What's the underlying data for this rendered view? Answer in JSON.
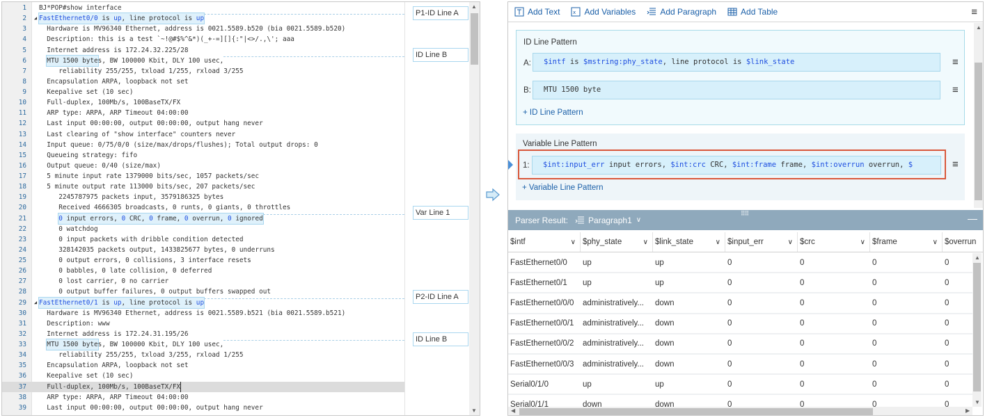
{
  "editor": {
    "lines": [
      {
        "n": "1",
        "pre": "",
        "hl": [],
        "rest": "BJ*POP#show interface"
      },
      {
        "n": "2",
        "mark": "◢",
        "pre": "",
        "hl": [
          {
            "t": "FastEthernet0/0",
            "v": true
          },
          {
            "t": " is "
          },
          {
            "t": "up",
            "v": true
          },
          {
            "t": ", line protocol is "
          },
          {
            "t": "up",
            "v": true
          }
        ],
        "rest": "",
        "dash": true
      },
      {
        "n": "3",
        "pre": "",
        "hl": [],
        "rest": "  Hardware is MV96340 Ethernet, address is 0021.5589.b520 (bia 0021.5589.b520)"
      },
      {
        "n": "4",
        "pre": "",
        "hl": [],
        "rest": "  Description: this is a test `~!@#$%^&*)(_+-=][]{:\"|<>/.,\\'; aaa"
      },
      {
        "n": "5",
        "pre": "",
        "hl": [],
        "rest": "  Internet address is 172.24.32.225/28"
      },
      {
        "n": "6",
        "pre": "  ",
        "hl": [
          {
            "t": "MTU 1500 byte"
          }
        ],
        "rest": "s, BW 100000 Kbit, DLY 100 usec,",
        "dash": true
      },
      {
        "n": "7",
        "pre": "",
        "hl": [],
        "rest": "     reliability 255/255, txload 1/255, rxload 3/255"
      },
      {
        "n": "8",
        "pre": "",
        "hl": [],
        "rest": "  Encapsulation ARPA, loopback not set"
      },
      {
        "n": "9",
        "pre": "",
        "hl": [],
        "rest": "  Keepalive set (10 sec)"
      },
      {
        "n": "10",
        "pre": "",
        "hl": [],
        "rest": "  Full-duplex, 100Mb/s, 100BaseTX/FX"
      },
      {
        "n": "11",
        "pre": "",
        "hl": [],
        "rest": "  ARP type: ARPA, ARP Timeout 04:00:00"
      },
      {
        "n": "12",
        "pre": "",
        "hl": [],
        "rest": "  Last input 00:00:00, output 00:00:00, output hang never"
      },
      {
        "n": "13",
        "pre": "",
        "hl": [],
        "rest": "  Last clearing of \"show interface\" counters never"
      },
      {
        "n": "14",
        "pre": "",
        "hl": [],
        "rest": "  Input queue: 0/75/0/0 (size/max/drops/flushes); Total output drops: 0"
      },
      {
        "n": "15",
        "pre": "",
        "hl": [],
        "rest": "  Queueing strategy: fifo"
      },
      {
        "n": "16",
        "pre": "",
        "hl": [],
        "rest": "  Output queue: 0/40 (size/max)"
      },
      {
        "n": "17",
        "pre": "",
        "hl": [],
        "rest": "  5 minute input rate 1379000 bits/sec, 1057 packets/sec"
      },
      {
        "n": "18",
        "pre": "",
        "hl": [],
        "rest": "  5 minute output rate 113000 bits/sec, 207 packets/sec"
      },
      {
        "n": "19",
        "pre": "",
        "hl": [],
        "rest": "     2245787975 packets input, 3579186325 bytes"
      },
      {
        "n": "20",
        "pre": "",
        "hl": [],
        "rest": "     Received 4666305 broadcasts, 0 runts, 0 giants, 0 throttles"
      },
      {
        "n": "21",
        "pre": "     ",
        "hl": [
          {
            "t": "0",
            "v": true
          },
          {
            "t": " input errors, "
          },
          {
            "t": "0",
            "v": true
          },
          {
            "t": " CRC, "
          },
          {
            "t": "0",
            "v": true
          },
          {
            "t": " frame, "
          },
          {
            "t": "0",
            "v": true
          },
          {
            "t": " overrun, "
          },
          {
            "t": "0",
            "v": true
          },
          {
            "t": " ignored"
          }
        ],
        "rest": "",
        "dash": true
      },
      {
        "n": "22",
        "pre": "",
        "hl": [],
        "rest": "     0 watchdog"
      },
      {
        "n": "23",
        "pre": "",
        "hl": [],
        "rest": "     0 input packets with dribble condition detected"
      },
      {
        "n": "24",
        "pre": "",
        "hl": [],
        "rest": "     328142035 packets output, 1433825677 bytes, 0 underruns"
      },
      {
        "n": "25",
        "pre": "",
        "hl": [],
        "rest": "     0 output errors, 0 collisions, 3 interface resets"
      },
      {
        "n": "26",
        "pre": "",
        "hl": [],
        "rest": "     0 babbles, 0 late collision, 0 deferred"
      },
      {
        "n": "27",
        "pre": "",
        "hl": [],
        "rest": "     0 lost carrier, 0 no carrier"
      },
      {
        "n": "28",
        "pre": "",
        "hl": [],
        "rest": "     0 output buffer failures, 0 output buffers swapped out"
      },
      {
        "n": "29",
        "mark": "◢",
        "pre": "",
        "hl": [
          {
            "t": "FastEthernet0/1",
            "v": true
          },
          {
            "t": " is "
          },
          {
            "t": "up",
            "v": true
          },
          {
            "t": ", line protocol is "
          },
          {
            "t": "up",
            "v": true
          }
        ],
        "rest": "",
        "dash": true
      },
      {
        "n": "30",
        "pre": "",
        "hl": [],
        "rest": "  Hardware is MV96340 Ethernet, address is 0021.5589.b521 (bia 0021.5589.b521)"
      },
      {
        "n": "31",
        "pre": "",
        "hl": [],
        "rest": "  Description: www"
      },
      {
        "n": "32",
        "pre": "",
        "hl": [],
        "rest": "  Internet address is 172.24.31.195/26"
      },
      {
        "n": "33",
        "pre": "  ",
        "hl": [
          {
            "t": "MTU 1500 byte"
          }
        ],
        "rest": "s, BW 100000 Kbit, DLY 100 usec,",
        "dash": true
      },
      {
        "n": "34",
        "pre": "",
        "hl": [],
        "rest": "     reliability 255/255, txload 3/255, rxload 1/255"
      },
      {
        "n": "35",
        "pre": "",
        "hl": [],
        "rest": "  Encapsulation ARPA, loopback not set"
      },
      {
        "n": "36",
        "pre": "",
        "hl": [],
        "rest": "  Keepalive set (10 sec)"
      },
      {
        "n": "37",
        "pre": "",
        "hl": [],
        "rest": "  Full-duplex, 100Mb/s, 100BaseTX/FX",
        "current": true
      },
      {
        "n": "38",
        "pre": "",
        "hl": [],
        "rest": "  ARP type: ARPA, ARP Timeout 04:00:00"
      },
      {
        "n": "39",
        "pre": "",
        "hl": [],
        "rest": "  Last input 00:00:00, output 00:00:00, output hang never"
      }
    ],
    "annotations": [
      "P1-ID Line A",
      "ID Line B",
      "Var Line 1",
      "P2-ID Line A",
      "ID Line B"
    ]
  },
  "toolbar": {
    "add_text": "Add Text",
    "add_variables": "Add Variables",
    "add_paragraph": "Add Paragraph",
    "add_table": "Add Table"
  },
  "id_pattern": {
    "title": "ID Line Pattern",
    "a_label": "A:",
    "a_segs": [
      {
        "t": "$intf",
        "v": true
      },
      {
        "t": " is "
      },
      {
        "t": "$mstring:phy_state",
        "v": true
      },
      {
        "t": ", line protocol is "
      },
      {
        "t": "$link_state",
        "v": true
      }
    ],
    "b_label": "B:",
    "b_value": "MTU 1500 byte",
    "add_label": "+ ID Line Pattern"
  },
  "var_pattern": {
    "title": "Variable Line Pattern",
    "label": "1:",
    "segs": [
      {
        "t": "$int:input_err",
        "v": true
      },
      {
        "t": " input errors, "
      },
      {
        "t": "$int:crc",
        "v": true
      },
      {
        "t": " CRC, "
      },
      {
        "t": "$int:frame",
        "v": true
      },
      {
        "t": " frame, "
      },
      {
        "t": "$int:overrun",
        "v": true
      },
      {
        "t": " overrun, "
      },
      {
        "t": "$",
        "v": true
      }
    ],
    "add_label": "+ Variable Line Pattern"
  },
  "result": {
    "label": "Parser Result:",
    "paragraph": "Paragraph1",
    "columns": [
      "$intf",
      "$phy_state",
      "$link_state",
      "$input_err",
      "$crc",
      "$frame",
      "$overrun"
    ],
    "rows": [
      [
        "FastEthernet0/0",
        "up",
        "up",
        "0",
        "0",
        "0",
        "0"
      ],
      [
        "FastEthernet0/1",
        "up",
        "up",
        "0",
        "0",
        "0",
        "0"
      ],
      [
        "FastEthernet0/0/0",
        "administratively...",
        "down",
        "0",
        "0",
        "0",
        "0"
      ],
      [
        "FastEthernet0/0/1",
        "administratively...",
        "down",
        "0",
        "0",
        "0",
        "0"
      ],
      [
        "FastEthernet0/0/2",
        "administratively...",
        "down",
        "0",
        "0",
        "0",
        "0"
      ],
      [
        "FastEthernet0/0/3",
        "administratively...",
        "down",
        "0",
        "0",
        "0",
        "0"
      ],
      [
        "Serial0/1/0",
        "up",
        "up",
        "0",
        "0",
        "0",
        "0"
      ],
      [
        "Serial0/1/1",
        "down",
        "down",
        "0",
        "0",
        "0",
        "0"
      ]
    ]
  },
  "colors": {
    "accent": "#1a5fa8",
    "highlight": "#dff1fb",
    "red_frame": "#d9573a",
    "result_header": "#8fa9bc"
  }
}
